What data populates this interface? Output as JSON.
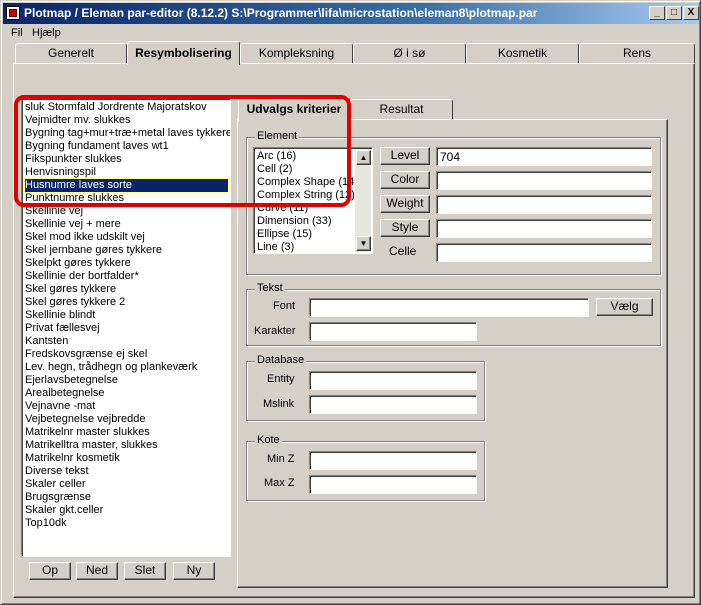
{
  "window": {
    "title": "Plotmap / Eleman par-editor (8.12.2) S:\\Programmer\\lifa\\microstation\\eleman8\\plotmap.par",
    "minimize_glyph": "_",
    "maximize_glyph": "□",
    "close_glyph": "X"
  },
  "menu": [
    "Fil",
    "Hjælp"
  ],
  "tabs": [
    "Generelt",
    "Resymbolisering",
    "Kompleksning",
    "Ø i sø",
    "Kosmetik",
    "Rens"
  ],
  "active_tab": "Resymbolisering",
  "rules_list": [
    "sluk Stormfald Jordrente Majoratskov",
    "Vejmidter mv. slukkes",
    "Bygning tag+mur+træ+metal laves tykkere",
    "Bygning fundament laves wt1",
    "Fikspunkter slukkes",
    "Henvisningspil",
    "Husnumre laves sorte",
    "Punktnumre slukkes",
    "Skellinie vej",
    "Skellinie vej + mere",
    "Skel mod ikke udskilt vej",
    "Skel jernbane gøres tykkere",
    "Skelpkt gøres tykkere",
    "Skellinie der bortfalder*",
    "Skel gøres tykkere",
    "Skel gøres tykkere 2",
    "Skellinie blindt",
    "Privat fællesvej",
    "Kantsten",
    "Fredskovsgrænse ej skel",
    "Lev. hegn, trådhegn og plankeværk",
    "Ejerlavsbetegnelse",
    "Arealbetegnelse",
    "Vejnavne -mat",
    "Vejbetegnelse vejbredde",
    "Matrikelnr master slukkes",
    "Matrikelltra master, slukkes",
    "Matrikelnr kosmetik",
    "Diverse tekst",
    "Skaler celler",
    "Brugsgrænse",
    "Skaler gkt.celler",
    "Top10dk"
  ],
  "selected_rule": "Husnumre laves sorte",
  "list_buttons": {
    "up": "Op",
    "down": "Ned",
    "delete": "Slet",
    "new": "Ny"
  },
  "subtabs": [
    "Udvalgs kriterier",
    "Resultat"
  ],
  "active_subtab": "Udvalgs kriterier",
  "element_group": {
    "legend": "Element",
    "types": [
      "Arc (16)",
      "Cell (2)",
      "Complex Shape (14",
      "Complex String (12)",
      "Curve (11)",
      "Dimension (33)",
      "Ellipse (15)",
      "Line (3)"
    ],
    "level_label": "Level",
    "level_value": "704",
    "color_label": "Color",
    "color_value": "",
    "weight_label": "Weight",
    "weight_value": "",
    "style_label": "Style",
    "style_value": "",
    "celle_label": "Celle",
    "celle_value": ""
  },
  "tekst_group": {
    "legend": "Tekst",
    "font_label": "Font",
    "font_value": "",
    "choose_button": "Vælg",
    "karakter_label": "Karakter",
    "karakter_value": ""
  },
  "database_group": {
    "legend": "Database",
    "entity_label": "Entity",
    "entity_value": "",
    "mslink_label": "Mslink",
    "mslink_value": ""
  },
  "kote_group": {
    "legend": "Kote",
    "minz_label": "Min Z",
    "minz_value": "",
    "maxz_label": "Max Z",
    "maxz_value": ""
  },
  "annotation_color": "#e00000",
  "selection_color": "#0a246a"
}
